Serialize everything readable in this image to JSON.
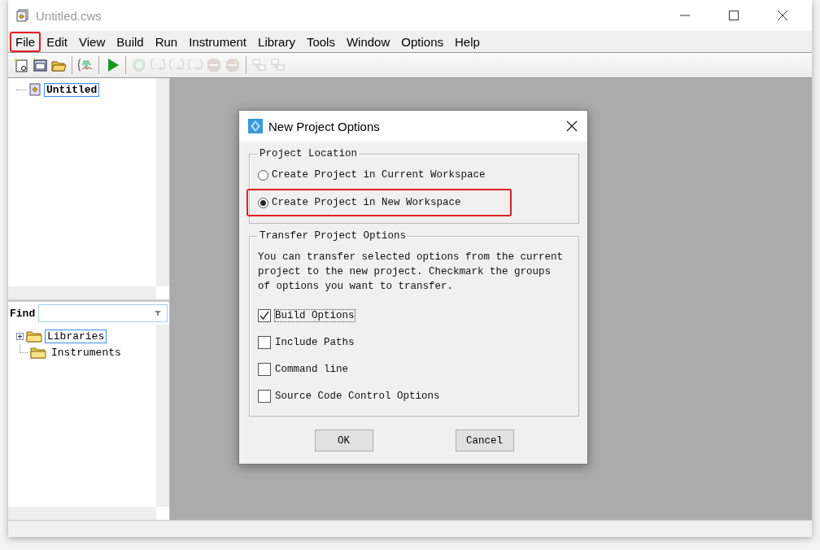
{
  "window": {
    "title": "Untitled.cws"
  },
  "menu": [
    {
      "label": "File",
      "highlighted": true
    },
    {
      "label": "Edit",
      "highlighted": false
    },
    {
      "label": "View",
      "highlighted": false
    },
    {
      "label": "Build",
      "highlighted": false
    },
    {
      "label": "Run",
      "highlighted": false
    },
    {
      "label": "Instrument",
      "highlighted": false
    },
    {
      "label": "Library",
      "highlighted": false
    },
    {
      "label": "Tools",
      "highlighted": false
    },
    {
      "label": "Window",
      "highlighted": false
    },
    {
      "label": "Options",
      "highlighted": false
    },
    {
      "label": "Help",
      "highlighted": false
    }
  ],
  "toolbar": [
    {
      "kind": "new-source",
      "disabled": false
    },
    {
      "kind": "new-panel",
      "disabled": false
    },
    {
      "kind": "open",
      "disabled": false
    },
    {
      "kind": "separator"
    },
    {
      "kind": "waveform",
      "disabled": false
    },
    {
      "kind": "separator"
    },
    {
      "kind": "run",
      "disabled": false
    },
    {
      "kind": "separator"
    },
    {
      "kind": "go",
      "disabled": true
    },
    {
      "kind": "step-into",
      "disabled": true
    },
    {
      "kind": "step-over",
      "disabled": true
    },
    {
      "kind": "step-out",
      "disabled": true
    },
    {
      "kind": "stop",
      "disabled": true
    },
    {
      "kind": "terminate",
      "disabled": true
    },
    {
      "kind": "separator"
    },
    {
      "kind": "tile-a",
      "disabled": true
    },
    {
      "kind": "tile-b",
      "disabled": true
    }
  ],
  "workspace_tree": [
    {
      "label": "Untitled",
      "selected": true
    }
  ],
  "find": {
    "label": "Find"
  },
  "library_tree": [
    {
      "label": "Libraries",
      "selected": true,
      "expanded": false
    },
    {
      "label": "Instruments",
      "selected": false
    }
  ],
  "dialog": {
    "title": "New Project Options",
    "location_group": {
      "title": "Project Location",
      "options": [
        {
          "label": "Create Project in Current Workspace",
          "selected": false,
          "highlighted": false
        },
        {
          "label": "Create Project in New Workspace",
          "selected": true,
          "highlighted": true
        }
      ]
    },
    "transfer_group": {
      "title": "Transfer Project Options",
      "description": "You can transfer selected options from the current project to the new project.  Checkmark the groups of options you want to transfer.",
      "options": [
        {
          "label": "Build Options",
          "checked": true,
          "focused": true
        },
        {
          "label": "Include Paths",
          "checked": false,
          "focused": false
        },
        {
          "label": "Command line",
          "checked": false,
          "focused": false
        },
        {
          "label": "Source Code Control Options",
          "checked": false,
          "focused": false
        }
      ]
    },
    "buttons": [
      "OK",
      "Cancel"
    ]
  }
}
